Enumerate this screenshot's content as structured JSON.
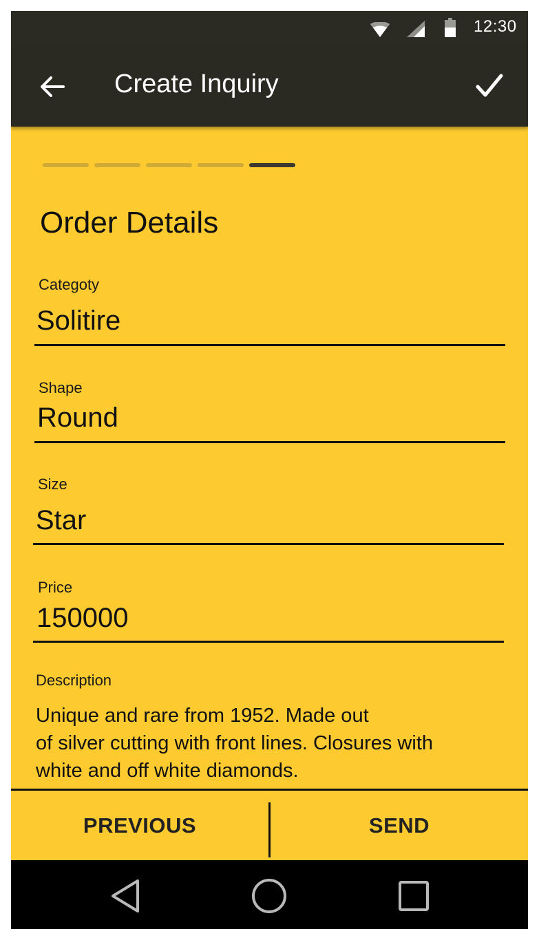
{
  "status_bar": {
    "time": "12:30",
    "icons": [
      "wifi-icon",
      "signal-icon",
      "battery-icon"
    ]
  },
  "app_bar": {
    "title": "Create Inquiry",
    "back_icon": "arrow-left-icon",
    "confirm_icon": "check-icon"
  },
  "stepper": {
    "total_steps": 5,
    "current_step": 5
  },
  "form": {
    "section_title": "Order Details",
    "category": {
      "label": "Categoty",
      "value": "Solitire"
    },
    "shape": {
      "label": "Shape",
      "value": "Round"
    },
    "size": {
      "label": "Size",
      "value": "Star"
    },
    "price": {
      "label": "Price",
      "value": "150000"
    },
    "description": {
      "label": "Description",
      "lines": [
        "Unique and rare from 1952. Made out",
        "of silver cutting with front lines. Closures with",
        "white and off white diamonds."
      ]
    }
  },
  "actions": {
    "previous": "PREVIOUS",
    "send": "SEND"
  },
  "nav_bar": {
    "icons": [
      "back-triangle-icon",
      "home-circle-icon",
      "recents-square-icon"
    ]
  },
  "colors": {
    "accent": "#FDCA30",
    "app_bar": "#2B2A22",
    "text": "#111111"
  }
}
